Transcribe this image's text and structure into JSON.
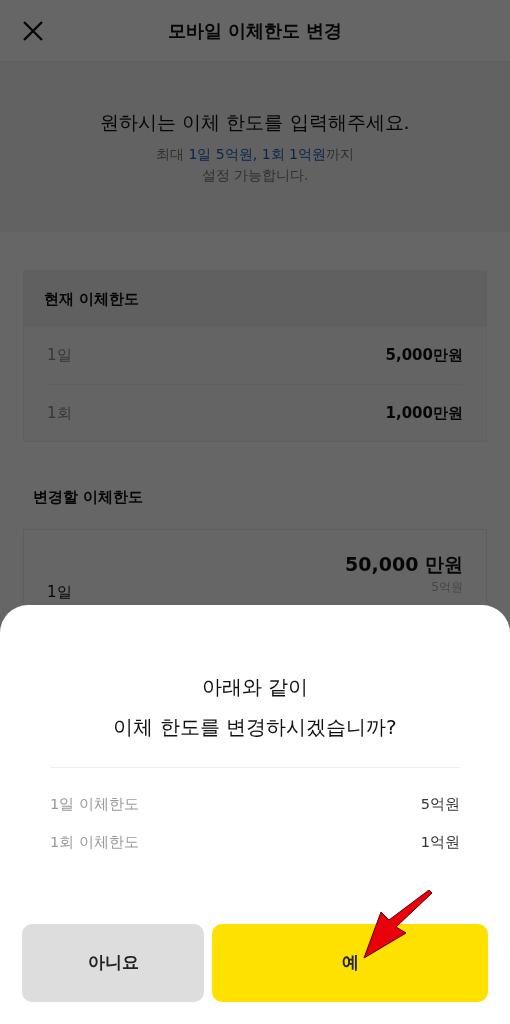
{
  "header": {
    "title": "모바일 이체한도 변경"
  },
  "intro": {
    "title": "원하시는 이체 한도를 입력해주세요.",
    "notice_lines": [
      [
        {
          "text": "최대 ",
          "highlight": false
        },
        {
          "text": "1일 5억원, 1회 1억원",
          "highlight": true
        },
        {
          "text": "까지",
          "highlight": false
        }
      ],
      [
        {
          "text": "설정 가능합니다.",
          "highlight": false
        }
      ]
    ]
  },
  "current_limit": {
    "title": "현재 이체한도",
    "rows": [
      {
        "label": "1일",
        "value": "5,000만원"
      },
      {
        "label": "1회",
        "value": "1,000만원"
      }
    ]
  },
  "new_limit": {
    "title": "변경할 이체한도",
    "rows": [
      {
        "label": "1일",
        "value": "50,000 만원",
        "hint": "5억원"
      }
    ]
  },
  "dialog": {
    "title_lines": [
      "아래와 같이",
      "이체 한도를 변경하시겠습니까?"
    ],
    "rows": [
      {
        "label": "1일 이체한도",
        "value": "5억원"
      },
      {
        "label": "1회 이체한도",
        "value": "1억원"
      }
    ],
    "buttons": [
      {
        "label": "아니요",
        "kind": "secondary"
      },
      {
        "label": "예",
        "kind": "primary"
      }
    ]
  }
}
